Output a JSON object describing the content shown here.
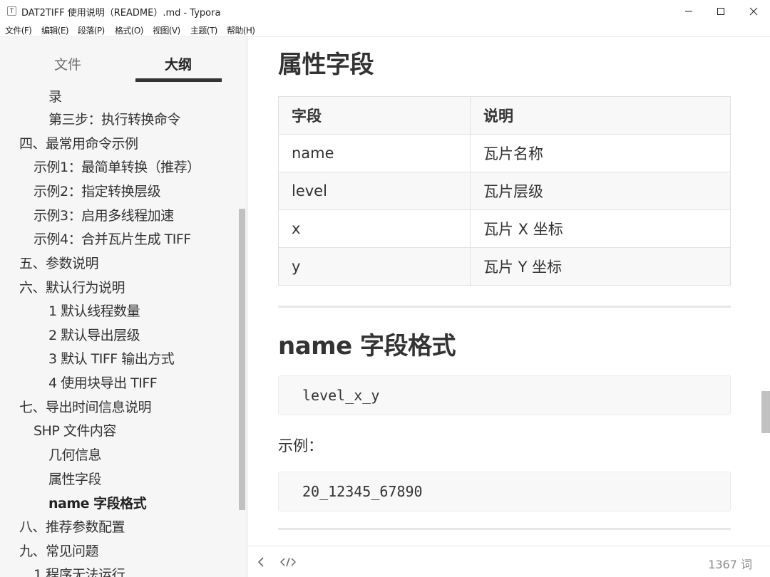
{
  "window": {
    "title": "DAT2TIFF 使用说明（README）.md - Typora",
    "app_icon_letter": "T"
  },
  "menu": [
    "文件(F)",
    "编辑(E)",
    "段落(P)",
    "格式(O)",
    "视图(V)",
    "主题(T)",
    "帮助(H)"
  ],
  "sidebar": {
    "tabs": [
      "文件",
      "大纲"
    ],
    "active_tab": "大纲",
    "outline": [
      {
        "label": "录",
        "level": 3
      },
      {
        "label": "第三步：执行转换命令",
        "level": 3
      },
      {
        "label": "四、最常用命令示例",
        "level": 1
      },
      {
        "label": "示例1：最简单转换（推荐）",
        "level": 2
      },
      {
        "label": "示例2：指定转换层级",
        "level": 2
      },
      {
        "label": "示例3：启用多线程加速",
        "level": 2
      },
      {
        "label": "示例4：合并瓦片生成 TIFF",
        "level": 2
      },
      {
        "label": "五、参数说明",
        "level": 1
      },
      {
        "label": "六、默认行为说明",
        "level": 1
      },
      {
        "label": "1 默认线程数量",
        "level": 3
      },
      {
        "label": "2 默认导出层级",
        "level": 3
      },
      {
        "label": "3 默认 TIFF 输出方式",
        "level": 3
      },
      {
        "label": "4 使用块导出 TIFF",
        "level": 3
      },
      {
        "label": "七、导出时间信息说明",
        "level": 1
      },
      {
        "label": "SHP 文件内容",
        "level": 2
      },
      {
        "label": "几何信息",
        "level": 3
      },
      {
        "label": "属性字段",
        "level": 3
      },
      {
        "label": "name 字段格式",
        "level": 3,
        "active": true
      },
      {
        "label": "八、推荐参数配置",
        "level": 1
      },
      {
        "label": "九、常见问题",
        "level": 1
      },
      {
        "label": "1 程序无法运行",
        "level": 2
      }
    ]
  },
  "content": {
    "heading_attrs": "属性字段",
    "table": {
      "headers": [
        "字段",
        "说明"
      ],
      "rows": [
        [
          "name",
          "瓦片名称"
        ],
        [
          "level",
          "瓦片层级"
        ],
        [
          "x",
          "瓦片 X 坐标"
        ],
        [
          "y",
          "瓦片 Y 坐标"
        ]
      ]
    },
    "heading_name": "name 字段格式",
    "code_format": "level_x_y",
    "example_label": "示例：",
    "code_example": "20_12345_67890"
  },
  "footer": {
    "word_count": "1367 词"
  },
  "colors": {
    "sidebar_bg": "#f6f6f6",
    "text": "#333333",
    "code_bg": "#f8f8f8"
  }
}
